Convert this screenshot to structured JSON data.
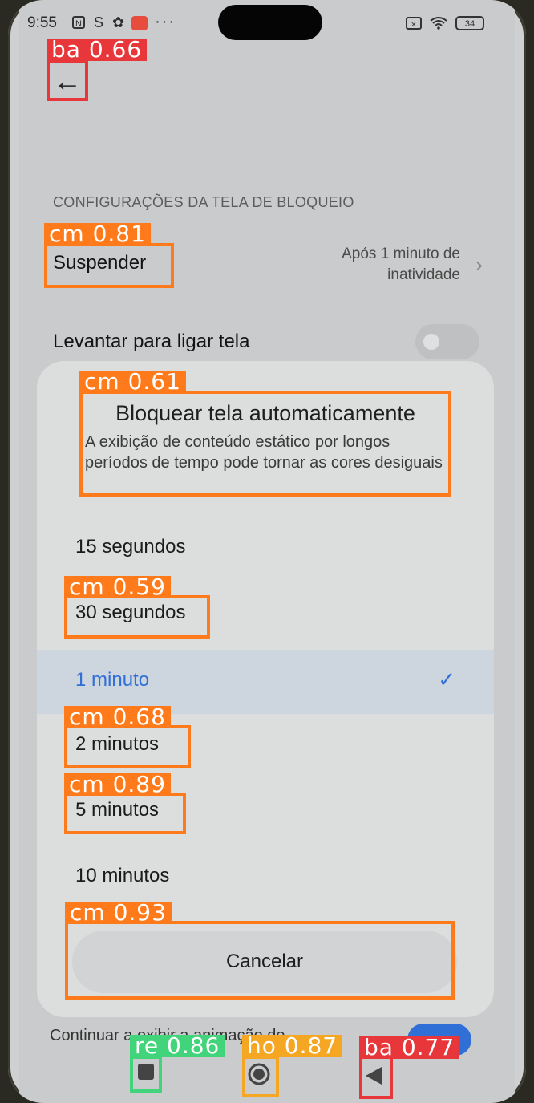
{
  "status": {
    "time": "9:55",
    "icons": [
      "nfc-icon",
      "sim-icon",
      "gear-icon",
      "mail-badge-icon",
      "more-dots"
    ],
    "battery": "34"
  },
  "settings": {
    "section_label": "CONFIGURAÇÕES DA TELA DE BLOQUEIO",
    "suspend_title": "Suspender",
    "suspend_value_line1": "Após 1 minuto de",
    "suspend_value_line2": "inatividade",
    "raise_title": "Levantar para ligar tela",
    "bottom_text": "Continuar a exibir a animação de"
  },
  "dialog": {
    "title": "Bloquear tela automaticamente",
    "description": "A exibição de conteúdo estático por longos períodos de tempo pode tornar as cores desiguais",
    "options": [
      {
        "label": "15 segundos",
        "selected": false
      },
      {
        "label": "30 segundos",
        "selected": false
      },
      {
        "label": "1 minuto",
        "selected": true
      },
      {
        "label": "2 minutos",
        "selected": false
      },
      {
        "label": "5 minutos",
        "selected": false
      },
      {
        "label": "10 minutos",
        "selected": false
      }
    ],
    "cancel": "Cancelar"
  },
  "detections": {
    "back_top": "ba 0.66",
    "suspender": "cm 0.81",
    "dialog_header": "cm 0.61",
    "opt30": "cm 0.59",
    "opt2": "cm 0.68",
    "opt5": "cm 0.89",
    "cancel": "cm 0.93",
    "recents": "re 0.86",
    "home": "ho 0.87",
    "back_nav": "ba 0.77"
  },
  "colors": {
    "accent": "#2f6fd6",
    "detect_orange": "#ff7a1a",
    "detect_red": "#e8373a",
    "detect_green": "#42d47a",
    "detect_yellow": "#f5a623"
  }
}
